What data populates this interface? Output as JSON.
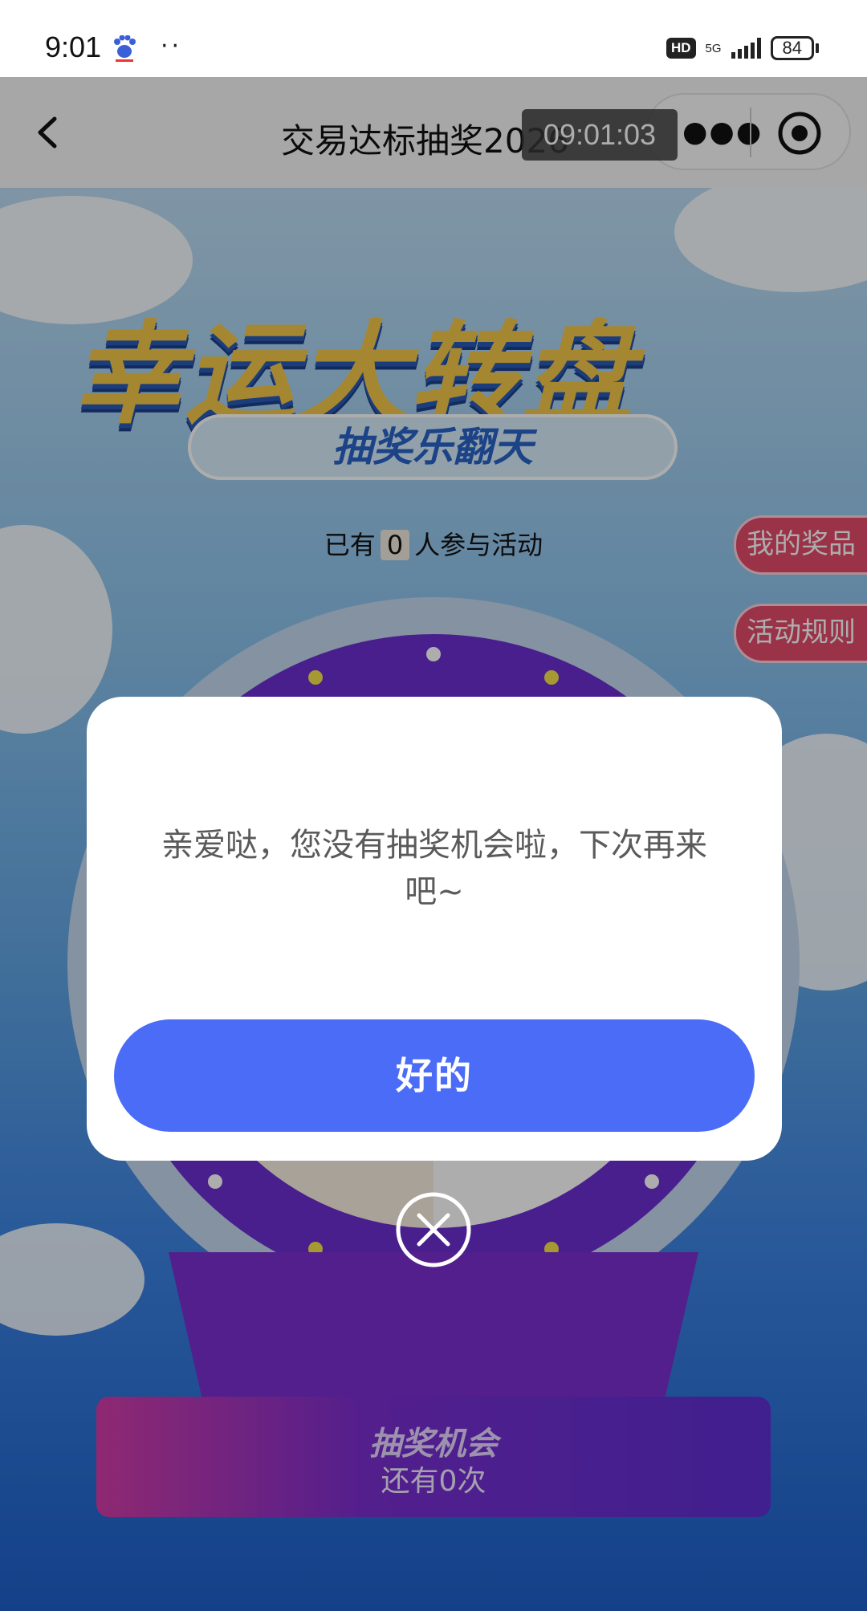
{
  "status_bar": {
    "time": "9:01",
    "dots": "··",
    "hd": "HD",
    "network": "5G",
    "battery": "84"
  },
  "header": {
    "title": "交易达标抽奖2026",
    "time_overlay": "09:01:03"
  },
  "game": {
    "banner_title": "幸运大转盘",
    "banner_subtitle": "抽奖乐翻天",
    "participants_prefix": "已有",
    "participants_count": "0",
    "participants_suffix": "人参与活动",
    "my_prizes": "我的奖品",
    "rules": "活动规则",
    "chances_label": "抽奖机会",
    "chances_count": "还有0次"
  },
  "modal": {
    "message": "亲爱哒，您没有抽奖机会啦，下次再来吧~",
    "ok_label": "好的"
  },
  "colors": {
    "primary_button": "#4a6cf7",
    "side_button": "#e44a6a",
    "wheel_ring": "#6a2fcf"
  }
}
